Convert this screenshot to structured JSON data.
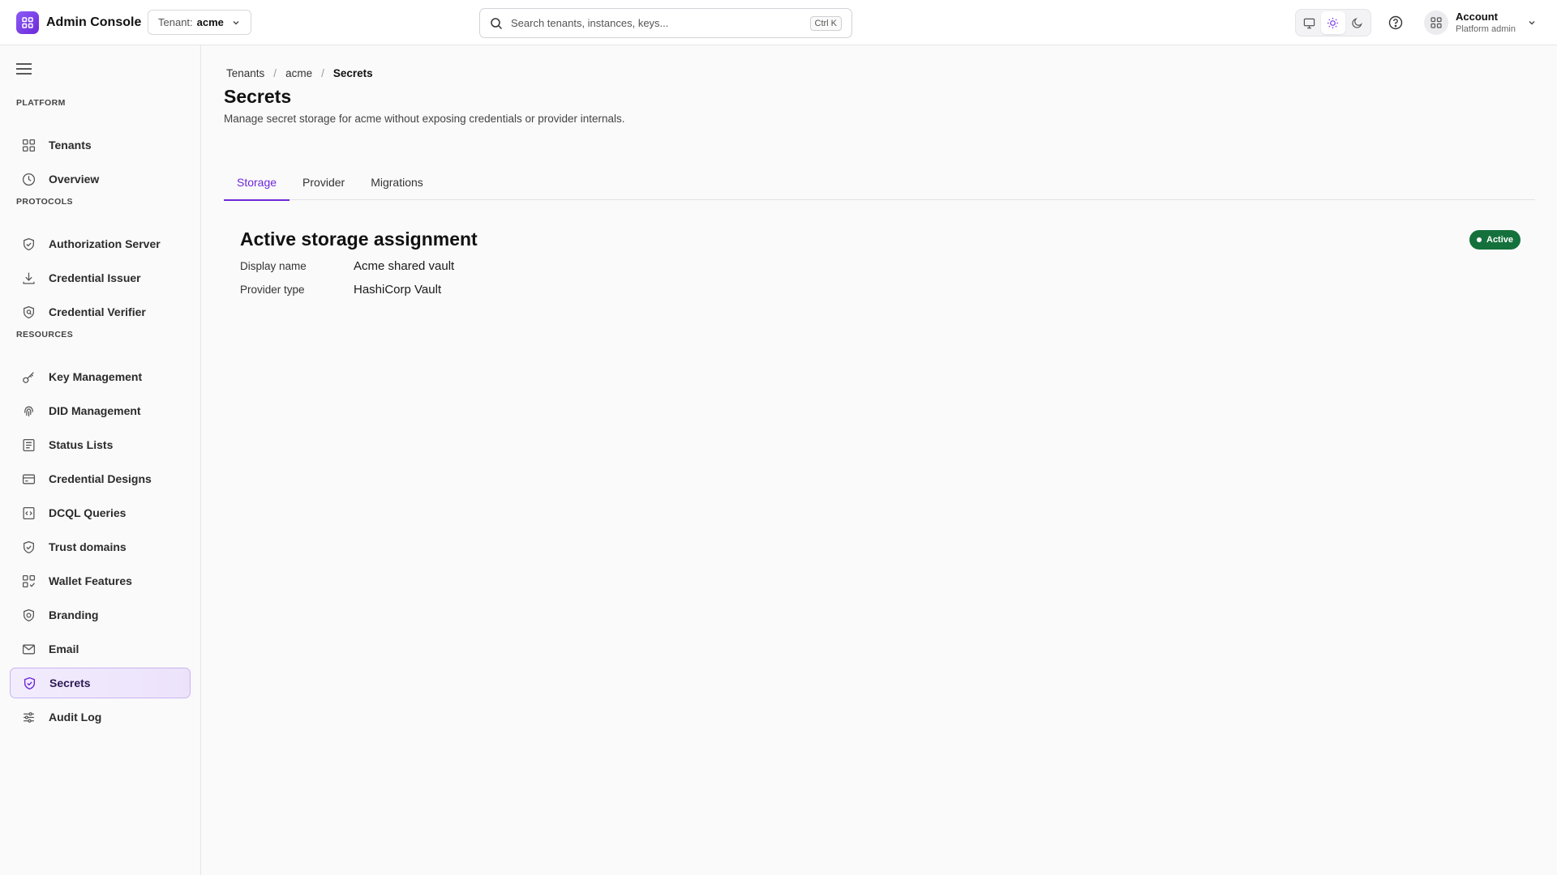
{
  "app": {
    "title": "Admin Console"
  },
  "tenant": {
    "label": "Tenant:",
    "value": "acme"
  },
  "search": {
    "placeholder": "Search tenants, instances, keys...",
    "shortcut": "Ctrl K"
  },
  "theme": {
    "options": [
      "system",
      "light",
      "dark"
    ],
    "selected": "light"
  },
  "account": {
    "name": "Account",
    "role": "Platform admin"
  },
  "sidebar": {
    "sections": [
      {
        "label": "PLATFORM",
        "items": [
          {
            "label": "Tenants",
            "icon": "grid-icon"
          },
          {
            "label": "Overview",
            "icon": "clock-icon"
          }
        ]
      },
      {
        "label": "PROTOCOLS",
        "items": [
          {
            "label": "Authorization Server",
            "icon": "shield-check-icon"
          },
          {
            "label": "Credential Issuer",
            "icon": "download-icon"
          },
          {
            "label": "Credential Verifier",
            "icon": "shield-search-icon"
          }
        ]
      },
      {
        "label": "RESOURCES",
        "items": [
          {
            "label": "Key Management",
            "icon": "key-icon"
          },
          {
            "label": "DID Management",
            "icon": "fingerprint-icon"
          },
          {
            "label": "Status Lists",
            "icon": "list-icon"
          },
          {
            "label": "Credential Designs",
            "icon": "card-icon"
          },
          {
            "label": "DCQL Queries",
            "icon": "code-file-icon"
          },
          {
            "label": "Trust domains",
            "icon": "shield-check-icon"
          },
          {
            "label": "Wallet Features",
            "icon": "grid-check-icon"
          },
          {
            "label": "Branding",
            "icon": "shield-brand-icon"
          },
          {
            "label": "Email",
            "icon": "mail-icon"
          },
          {
            "label": "Secrets",
            "icon": "shield-check-icon",
            "active": true
          },
          {
            "label": "Audit Log",
            "icon": "sliders-icon"
          }
        ]
      }
    ]
  },
  "breadcrumb": [
    "Tenants",
    "acme",
    "Secrets"
  ],
  "page": {
    "title": "Secrets",
    "subtitle": "Manage secret storage for acme without exposing credentials or provider internals."
  },
  "tabs": [
    {
      "label": "Storage",
      "active": true
    },
    {
      "label": "Provider"
    },
    {
      "label": "Migrations"
    }
  ],
  "assignment": {
    "title": "Active storage assignment",
    "status": "Active",
    "status_color": "#14713b",
    "fields": [
      {
        "label": "Display name",
        "value": "Acme shared vault"
      },
      {
        "label": "Provider type",
        "value": "HashiCorp Vault"
      }
    ]
  },
  "colors": {
    "accent": "#6d28d9",
    "active_badge": "#14713b"
  }
}
